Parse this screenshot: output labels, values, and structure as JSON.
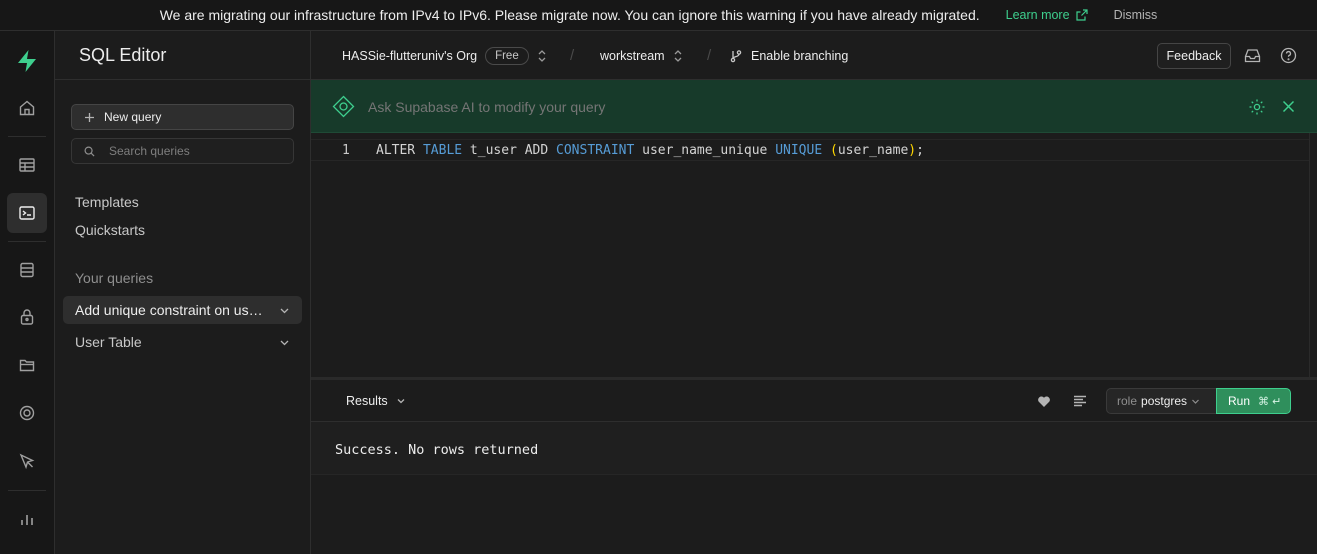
{
  "banner": {
    "message": "We are migrating our infrastructure from IPv4 to IPv6. Please migrate now. You can ignore this warning if you have already migrated.",
    "learn_more": "Learn more",
    "dismiss": "Dismiss"
  },
  "nav_rail": {
    "items": [
      "home-icon",
      "table-editor-icon",
      "sql-editor-icon",
      "database-icon",
      "auth-icon",
      "storage-icon",
      "realtime-icon",
      "advisors-icon",
      "reports-icon"
    ],
    "active": "sql-editor-icon"
  },
  "sidebar": {
    "title": "SQL Editor",
    "new_query": "New query",
    "search_placeholder": "Search queries",
    "links": [
      "Templates",
      "Quickstarts"
    ],
    "section_label": "Your queries",
    "queries": [
      {
        "label": "Add unique constraint on user_name"
      },
      {
        "label": "User Table"
      }
    ]
  },
  "topbar": {
    "org": "HASSie-flutteruniv's Org",
    "plan": "Free",
    "project": "workstream",
    "branching": "Enable branching",
    "feedback": "Feedback"
  },
  "ai_bar": {
    "placeholder": "Ask Supabase AI to modify your query"
  },
  "editor": {
    "line_number": "1",
    "tokens": {
      "t1": "ALTER ",
      "t2": "TABLE",
      "t3": " t_user ADD ",
      "t4": "CONSTRAINT",
      "t5": " user_name_unique ",
      "t6": "UNIQUE",
      "t7": " ",
      "t8": "(",
      "t9": "user_name",
      "t10": ")",
      "t11": ";"
    }
  },
  "results": {
    "tab_label": "Results",
    "role_key": "role",
    "role_value": "postgres",
    "run_label": "Run",
    "run_shortcut": "⌘ ↵",
    "message": "Success. No rows returned"
  },
  "colors": {
    "brand": "#3ecf8e",
    "background": "#1c1c1c",
    "ai_bar": "#173a2a"
  }
}
